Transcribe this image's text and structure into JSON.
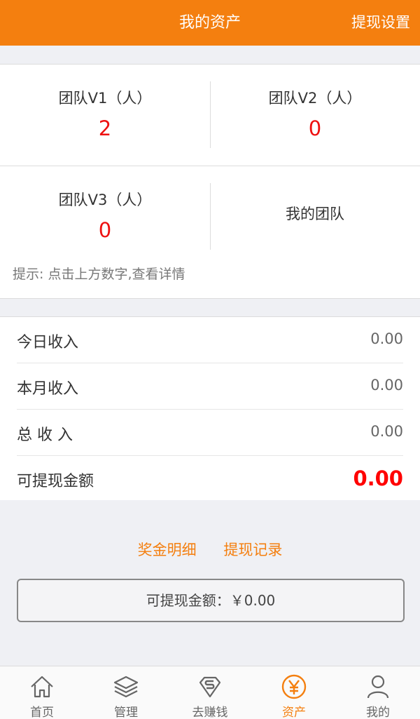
{
  "header": {
    "title": "我的资产",
    "right_button": "提现设置"
  },
  "team": {
    "v1": {
      "label": "团队V1（人）",
      "value": "2"
    },
    "v2": {
      "label": "团队V2（人）",
      "value": "0"
    },
    "v3": {
      "label": "团队V3（人）",
      "value": "0"
    },
    "my_team": "我的团队",
    "hint": "提示: 点击上方数字,查看详情"
  },
  "income": [
    {
      "label": "今日收入",
      "value": "0.00"
    },
    {
      "label": "本月收入",
      "value": "0.00"
    },
    {
      "label": "总 收 入",
      "value": "0.00"
    },
    {
      "label": "可提现金额",
      "value": "0.00"
    }
  ],
  "links": {
    "bonus_detail": "奖金明细",
    "withdraw_record": "提现记录"
  },
  "withdraw_button": "可提现金额：￥0.00",
  "tabs": [
    {
      "label": "首页",
      "icon": "home-icon"
    },
    {
      "label": "管理",
      "icon": "layers-icon"
    },
    {
      "label": "去赚钱",
      "icon": "superman-icon"
    },
    {
      "label": "资产",
      "icon": "yuan-icon",
      "active": true
    },
    {
      "label": "我的",
      "icon": "user-icon"
    }
  ],
  "colors": {
    "accent": "#f47f0f",
    "value_red": "#ff0000",
    "background": "#eff0f4"
  }
}
